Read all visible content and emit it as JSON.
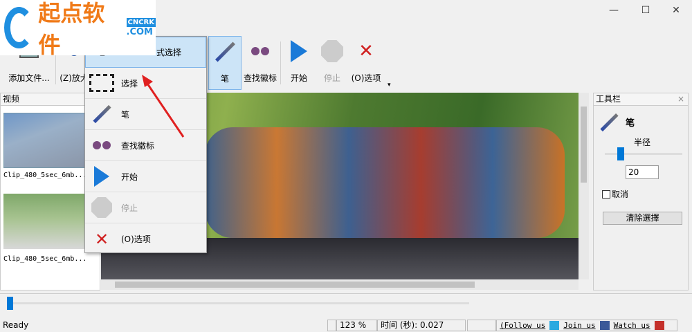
{
  "window": {
    "minimize": "—",
    "maximize": "☐",
    "close": "✕"
  },
  "logo": {
    "text": "起点软件",
    "badge": "CNCRK",
    ".com": ".COM"
  },
  "toolbar": {
    "items": [
      {
        "label": "添加文件...",
        "icon": "add-file-icon"
      },
      {
        "label": "(Z)放大",
        "icon": "zoom-icon"
      },
      {
        "label": "笔",
        "icon": "pen-icon",
        "active": true
      },
      {
        "label": "查找徽标",
        "icon": "binoculars-icon"
      },
      {
        "label": "开始",
        "icon": "play-icon"
      },
      {
        "label": "停止",
        "icon": "stop-icon",
        "disabled": true
      },
      {
        "label": "(O)选项",
        "icon": "options-icon"
      }
    ],
    "overflow": "▾"
  },
  "menu": {
    "items": [
      {
        "label": "式选择",
        "highlighted": true
      },
      {
        "label": "选择"
      },
      {
        "label": "笔"
      },
      {
        "label": "查找徽标"
      },
      {
        "label": "开始"
      },
      {
        "label": "停止",
        "disabled": true
      },
      {
        "label": "(O)选项"
      }
    ]
  },
  "left_panel": {
    "title": "视频",
    "clips": [
      {
        "name": "Clip_480_5sec_6mb..."
      },
      {
        "name": "Clip_480_5sec_6mb..."
      }
    ]
  },
  "right_panel": {
    "title": "工具栏",
    "close": "×",
    "tool": "笔",
    "radius_label": "半径",
    "radius_value": "20",
    "radius_slider_fraction": 0.18,
    "cancel_label": "取消",
    "cancel_checked": false,
    "clear_button": "清除選擇"
  },
  "timeline": {
    "position_fraction": 0.0
  },
  "status": {
    "ready": "Ready",
    "zoom": "123 %",
    "time": "时间 (秒): 0.027",
    "follow": "(Follow us",
    "join": "Join us",
    "watch": "Watch us"
  },
  "colors": {
    "accent": "#0078d7",
    "highlight": "#cce4f7",
    "arrow": "#e02020"
  }
}
